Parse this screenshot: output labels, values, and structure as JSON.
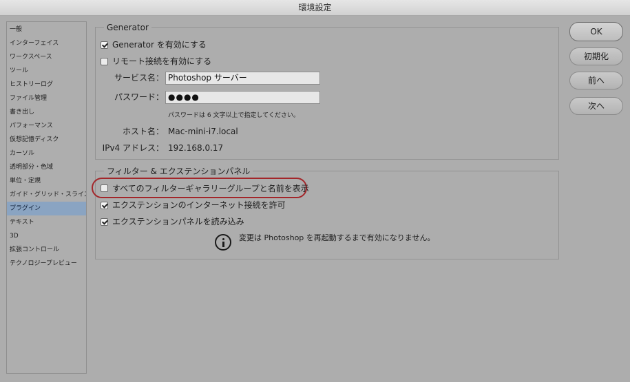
{
  "window": {
    "title": "環境設定"
  },
  "sidebar": {
    "items": [
      {
        "label": "一般",
        "selected": false
      },
      {
        "label": "インターフェイス",
        "selected": false
      },
      {
        "label": "ワークスペース",
        "selected": false
      },
      {
        "label": "ツール",
        "selected": false
      },
      {
        "label": "ヒストリーログ",
        "selected": false
      },
      {
        "label": "ファイル管理",
        "selected": false
      },
      {
        "label": "書き出し",
        "selected": false
      },
      {
        "label": "パフォーマンス",
        "selected": false
      },
      {
        "label": "仮想記憶ディスク",
        "selected": false
      },
      {
        "label": "カーソル",
        "selected": false
      },
      {
        "label": "透明部分・色域",
        "selected": false
      },
      {
        "label": "単位・定規",
        "selected": false
      },
      {
        "label": "ガイド・グリッド・スライス",
        "selected": false
      },
      {
        "label": "プラグイン",
        "selected": true
      },
      {
        "label": "テキスト",
        "selected": false
      },
      {
        "label": "3D",
        "selected": false
      },
      {
        "label": "拡張コントロール",
        "selected": false
      },
      {
        "label": "テクノロジープレビュー",
        "selected": false
      }
    ]
  },
  "generator": {
    "title": "Generator",
    "enable_label": "Generator を有効にする",
    "enable_checked": true,
    "remote_label": "リモート接続を有効にする",
    "remote_checked": false,
    "service_label": "サービス名：",
    "service_value": "Photoshop サーバー",
    "password_label": "パスワード：",
    "password_value": "●●●●",
    "password_hint": "パスワードは 6 文字以上で指定してください。",
    "host_label": "ホスト名：",
    "host_value": "Mac-mini-i7.local",
    "ipv4_label": "IPv4 アドレス：",
    "ipv4_value": "192.168.0.17"
  },
  "filters": {
    "title": "フィルター & エクステンションパネル",
    "gallery_label": "すべてのフィルターギャラリーグループと名前を表示",
    "gallery_checked": false,
    "internet_label": "エクステンションのインターネット接続を許可",
    "internet_checked": true,
    "load_label": "エクステンションパネルを読み込み",
    "load_checked": true,
    "notice": "変更は Photoshop を再起動するまで有効になりません。"
  },
  "buttons": {
    "ok": "OK",
    "reset": "初期化",
    "prev": "前へ",
    "next": "次へ"
  },
  "colors": {
    "highlight": "#a3262a",
    "selection": "#8aa4c2"
  },
  "icons": {
    "notice": "info-icon"
  }
}
